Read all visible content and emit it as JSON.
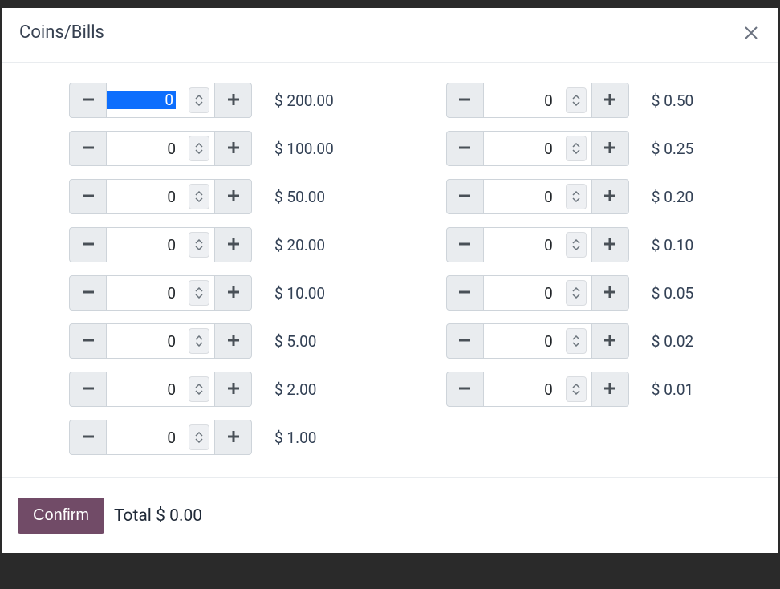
{
  "header": {
    "title": "Coins/Bills"
  },
  "currency": "$",
  "leftColumn": [
    {
      "value": "0",
      "label": "$ 200.00",
      "selected": true
    },
    {
      "value": "0",
      "label": "$ 100.00",
      "selected": false
    },
    {
      "value": "0",
      "label": "$ 50.00",
      "selected": false
    },
    {
      "value": "0",
      "label": "$ 20.00",
      "selected": false
    },
    {
      "value": "0",
      "label": "$ 10.00",
      "selected": false
    },
    {
      "value": "0",
      "label": "$ 5.00",
      "selected": false
    },
    {
      "value": "0",
      "label": "$ 2.00",
      "selected": false
    },
    {
      "value": "0",
      "label": "$ 1.00",
      "selected": false
    }
  ],
  "rightColumn": [
    {
      "value": "0",
      "label": "$ 0.50",
      "selected": false
    },
    {
      "value": "0",
      "label": "$ 0.25",
      "selected": false
    },
    {
      "value": "0",
      "label": "$ 0.20",
      "selected": false
    },
    {
      "value": "0",
      "label": "$ 0.10",
      "selected": false
    },
    {
      "value": "0",
      "label": "$ 0.05",
      "selected": false
    },
    {
      "value": "0",
      "label": "$ 0.02",
      "selected": false
    },
    {
      "value": "0",
      "label": "$ 0.01",
      "selected": false
    }
  ],
  "footer": {
    "confirm_label": "Confirm",
    "total_label": "Total",
    "total_value": "$ 0.00"
  }
}
